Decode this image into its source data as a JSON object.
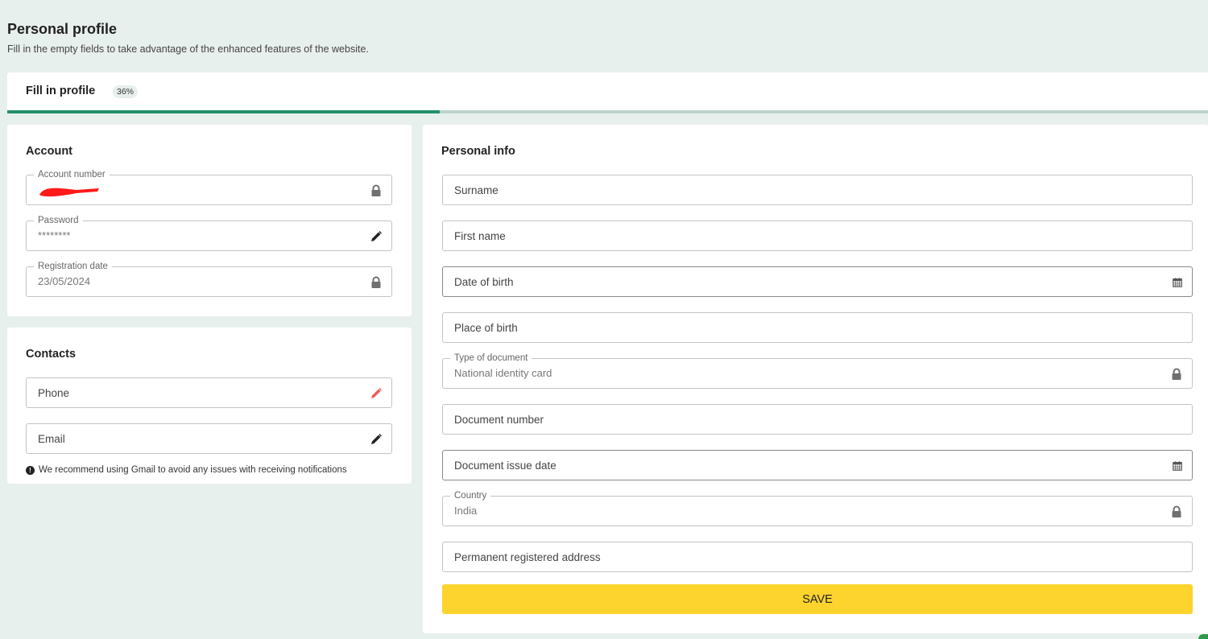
{
  "header": {
    "title": "Personal profile",
    "subtitle": "Fill in the empty fields to take advantage of the enhanced features of the website."
  },
  "progress": {
    "label": "Fill in profile",
    "percent_text": "36%",
    "percent": 36,
    "fill_color": "#22916a"
  },
  "account": {
    "title": "Account",
    "fields": [
      {
        "label": "Account number",
        "value": "[redacted]",
        "icon": "lock-icon"
      },
      {
        "label": "Password",
        "value": "********",
        "icon": "pencil-icon"
      },
      {
        "label": "Registration date",
        "value": "23/05/2024",
        "icon": "lock-icon"
      }
    ]
  },
  "contacts": {
    "title": "Contacts",
    "fields": [
      {
        "placeholder": "Phone",
        "icon": "pencil-icon",
        "icon_color": "#f05a5a"
      },
      {
        "placeholder": "Email",
        "icon": "pencil-icon"
      }
    ],
    "note": "We recommend using Gmail to avoid any issues with receiving notifications"
  },
  "personal_info": {
    "title": "Personal info",
    "fields": [
      {
        "placeholder": "Surname"
      },
      {
        "placeholder": "First name"
      },
      {
        "placeholder": "Date of birth",
        "icon": "calendar-icon"
      },
      {
        "placeholder": "Place of birth"
      },
      {
        "label": "Type of document",
        "value": "National identity card",
        "icon": "lock-icon"
      },
      {
        "placeholder": "Document number"
      },
      {
        "placeholder": "Document issue date",
        "icon": "calendar-icon"
      },
      {
        "label": "Country",
        "value": "India",
        "icon": "lock-icon"
      },
      {
        "placeholder": "Permanent registered address"
      }
    ],
    "save_label": "SAVE",
    "save_color": "#fdd42d"
  }
}
